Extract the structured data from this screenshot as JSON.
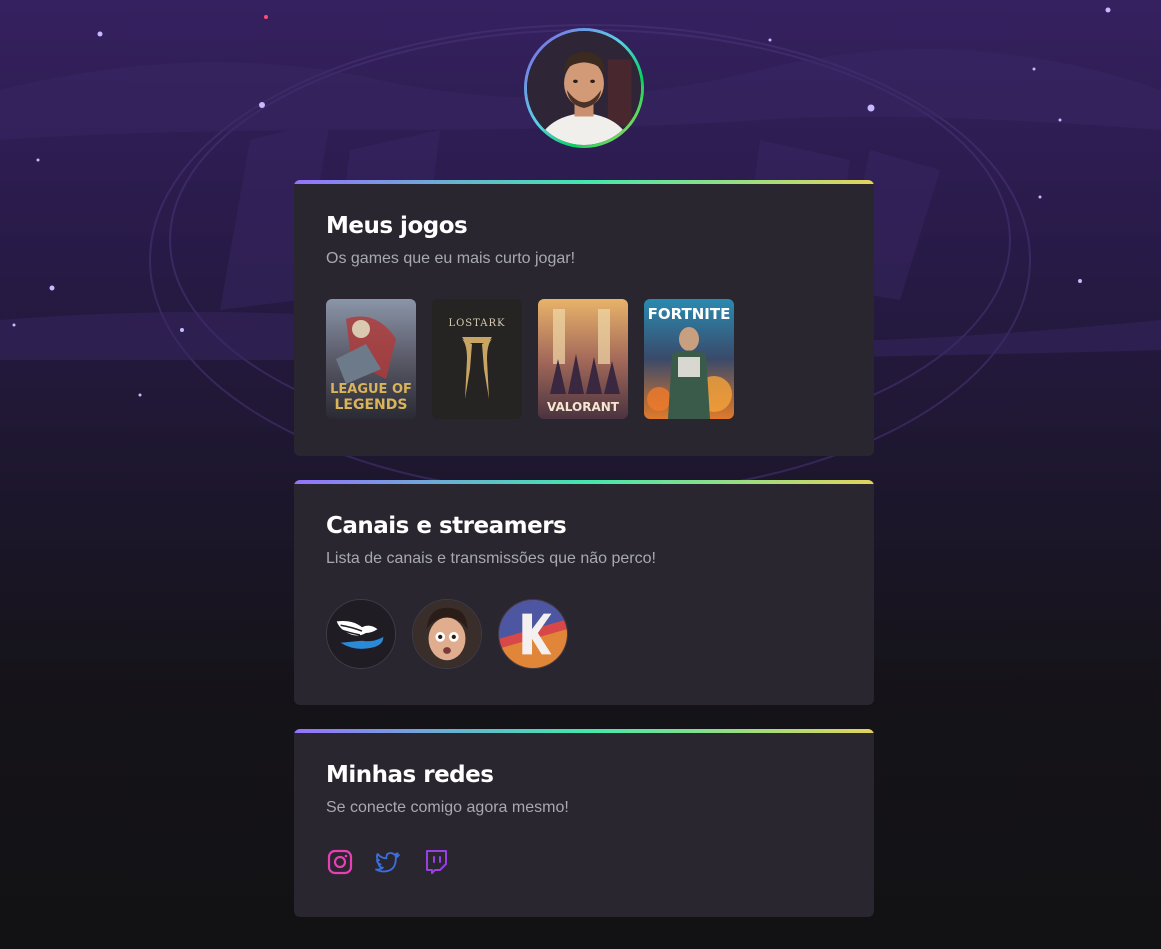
{
  "profile": {
    "avatar_alt": "Profile photo"
  },
  "games_card": {
    "title": "Meus jogos",
    "subtitle": "Os games que eu mais curto jogar!",
    "games": [
      {
        "name": "League of Legends",
        "cover_line1": "LEAGUE OF",
        "cover_line2": "LEGENDS"
      },
      {
        "name": "Lost Ark",
        "cover_line1": "LOSTARK"
      },
      {
        "name": "Valorant",
        "cover_line1": "VALORANT"
      },
      {
        "name": "Fortnite",
        "cover_line1": "FORTNITE"
      }
    ]
  },
  "channels_card": {
    "title": "Canais e streamers",
    "subtitle": "Lista de canais e transmissões que não perco!",
    "channels": [
      {
        "icon": "winged-logo-icon"
      },
      {
        "icon": "streamer-face-avatar"
      },
      {
        "icon": "k-logo-icon"
      }
    ]
  },
  "social_card": {
    "title": "Minhas redes",
    "subtitle": "Se conecte comigo agora mesmo!",
    "links": [
      {
        "icon": "instagram-icon",
        "color": "#e83fb5"
      },
      {
        "icon": "twitter-icon",
        "color": "#3b6fe0"
      },
      {
        "icon": "twitch-icon",
        "color": "#9b3ee3"
      }
    ]
  },
  "colors": {
    "card_bg": "#29262f",
    "accent_gradient": [
      "#9572fc",
      "#43e7ad",
      "#e2d45c"
    ],
    "text_muted": "#a8a8b3"
  }
}
